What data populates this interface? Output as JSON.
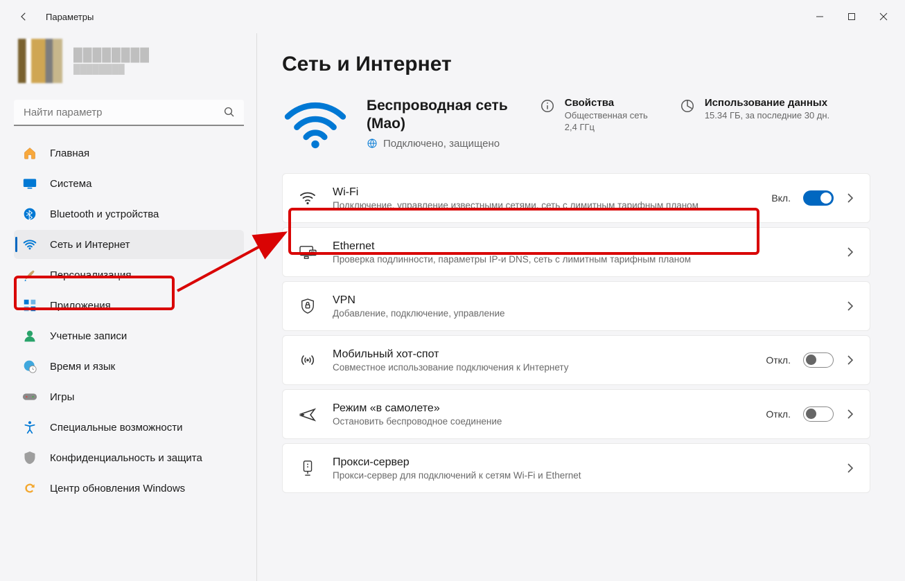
{
  "window": {
    "title": "Параметры"
  },
  "user": {
    "name": "████████",
    "email": "████████"
  },
  "search": {
    "placeholder": "Найти параметр"
  },
  "sidebar": {
    "items": [
      {
        "label": "Главная",
        "icon": "home"
      },
      {
        "label": "Система",
        "icon": "system"
      },
      {
        "label": "Bluetooth и устройства",
        "icon": "bluetooth"
      },
      {
        "label": "Сеть и Интернет",
        "icon": "network",
        "active": true
      },
      {
        "label": "Персонализация",
        "icon": "personalization"
      },
      {
        "label": "Приложения",
        "icon": "apps"
      },
      {
        "label": "Учетные записи",
        "icon": "accounts"
      },
      {
        "label": "Время и язык",
        "icon": "time"
      },
      {
        "label": "Игры",
        "icon": "gaming"
      },
      {
        "label": "Специальные возможности",
        "icon": "accessibility"
      },
      {
        "label": "Конфиденциальность и защита",
        "icon": "privacy"
      },
      {
        "label": "Центр обновления Windows",
        "icon": "update"
      }
    ]
  },
  "page": {
    "title": "Сеть и Интернет",
    "status": {
      "title_line1": "Беспроводная сеть",
      "title_line2": "(Mao)",
      "subtitle": "Подключено, защищено"
    },
    "properties": {
      "title": "Свойства",
      "line1": "Общественная сеть",
      "line2": "2,4 ГГц"
    },
    "data_usage": {
      "title": "Использование данных",
      "line1": "15.34 ГБ, за последние 30 дн."
    },
    "settings": [
      {
        "id": "wifi",
        "title": "Wi-Fi",
        "sub": "Подключение, управление известными сетями, сеть с лимитным тарифным планом",
        "toggle": "on",
        "toggle_label": "Вкл."
      },
      {
        "id": "ethernet",
        "title": "Ethernet",
        "sub": "Проверка подлинности, параметры IP-и DNS, сеть с лимитным тарифным планом"
      },
      {
        "id": "vpn",
        "title": "VPN",
        "sub": "Добавление, подключение, управление"
      },
      {
        "id": "hotspot",
        "title": "Мобильный хот-спот",
        "sub": "Совместное использование подключения к Интернету",
        "toggle": "off",
        "toggle_label": "Откл."
      },
      {
        "id": "airplane",
        "title": "Режим «в самолете»",
        "sub": "Остановить беспроводное соединение",
        "toggle": "off",
        "toggle_label": "Откл."
      },
      {
        "id": "proxy",
        "title": "Прокси-сервер",
        "sub": "Прокси-сервер для подключений к сетям Wi-Fi и Ethernet"
      }
    ]
  }
}
